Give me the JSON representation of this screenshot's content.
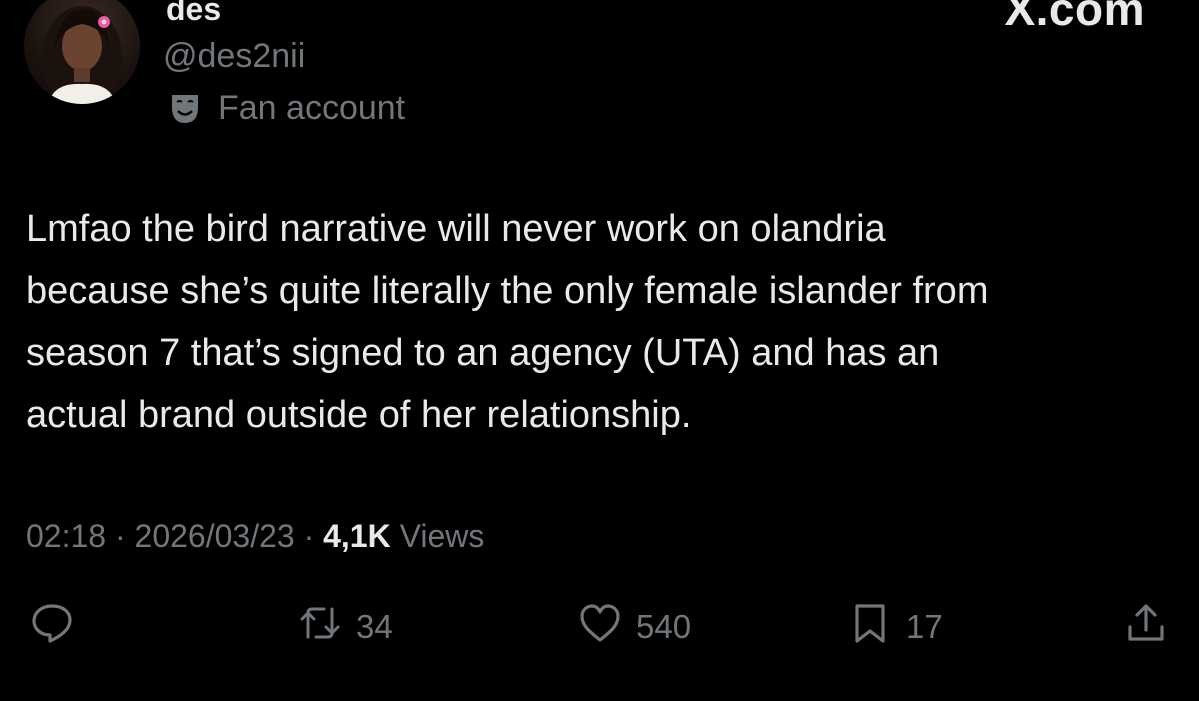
{
  "account": {
    "display_name": "des",
    "handle": "@des2nii",
    "badge_label": "Fan account",
    "badge_icon": "theater-mask-icon"
  },
  "site_mark": "X.com",
  "tweet": {
    "text": "Lmfao the bird narrative will never work on olandria\nbecause she’s quite literally the only female islander from\nseason 7 that’s signed to an agency (UTA) and has an\nactual brand outside of her relationship."
  },
  "meta": {
    "time": "02:18",
    "separator": " · ",
    "date": "2026/03/23",
    "views_count": "4,1K",
    "views_label": "Views"
  },
  "actions": {
    "reply": {
      "icon": "reply-icon",
      "count": ""
    },
    "retweet": {
      "icon": "retweet-icon",
      "count": "34"
    },
    "like": {
      "icon": "heart-icon",
      "count": "540"
    },
    "bookmark": {
      "icon": "bookmark-icon",
      "count": "17"
    },
    "share": {
      "icon": "share-icon"
    }
  },
  "colors": {
    "background": "#000000",
    "primary_text": "#e7e9ea",
    "secondary_text": "#71767b"
  }
}
